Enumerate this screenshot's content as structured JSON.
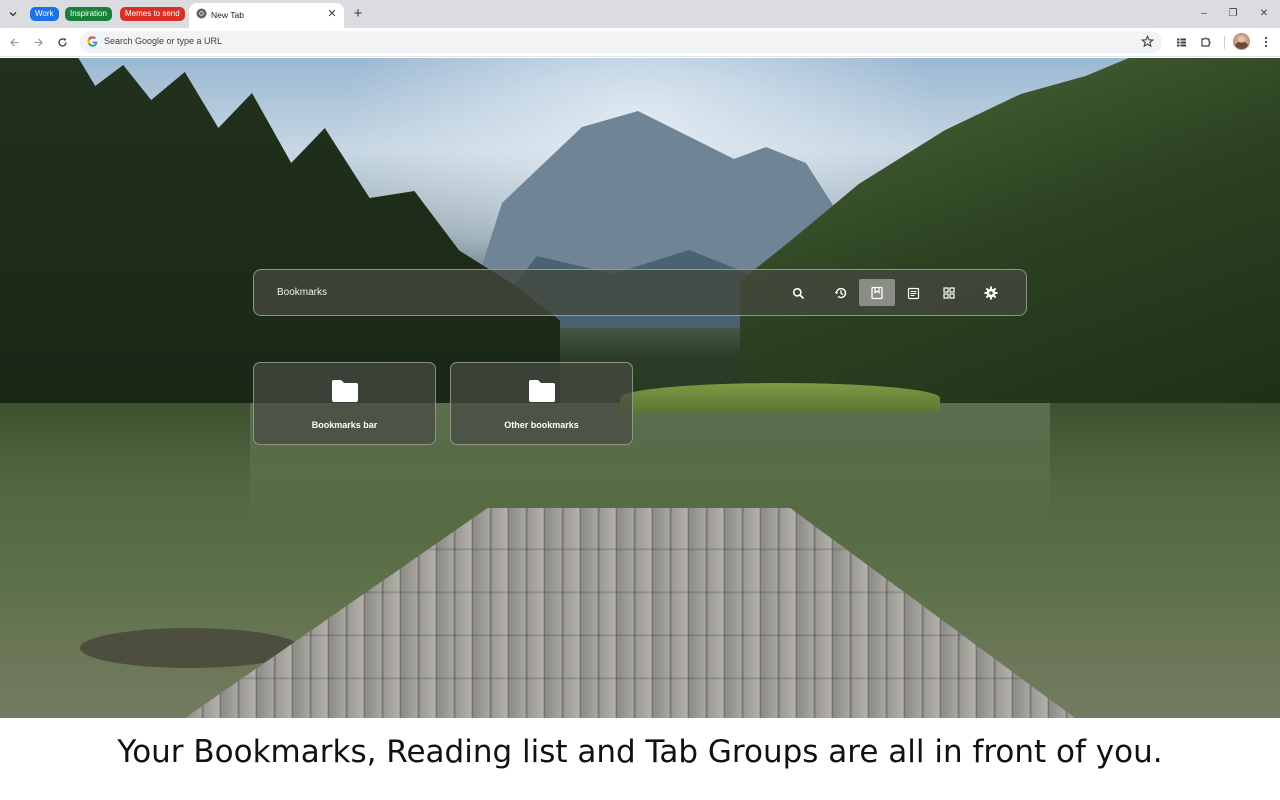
{
  "tab_strip": {
    "groups": [
      {
        "label": "Work",
        "color": "#1a73e8"
      },
      {
        "label": "Inspiration",
        "color": "#188038"
      },
      {
        "label": "Memes to send",
        "color": "#d93025"
      }
    ],
    "active_tab": {
      "title": "New Tab",
      "close": "✕"
    },
    "new_tab": "+",
    "window_controls": {
      "minimize": "–",
      "restore": "❐",
      "close": "✕"
    }
  },
  "toolbar": {
    "omnibox_placeholder": "Search Google or type a URL"
  },
  "panel": {
    "title": "Bookmarks",
    "icons": [
      "search-icon",
      "history-icon",
      "bookmarks-icon",
      "reading-list-icon",
      "tab-groups-icon",
      "settings-icon"
    ],
    "active_icon": "bookmarks-icon",
    "folders": [
      {
        "label": "Bookmarks bar"
      },
      {
        "label": "Other bookmarks"
      }
    ]
  },
  "caption": "Your Bookmarks, Reading list and Tab Groups are all in front of you."
}
